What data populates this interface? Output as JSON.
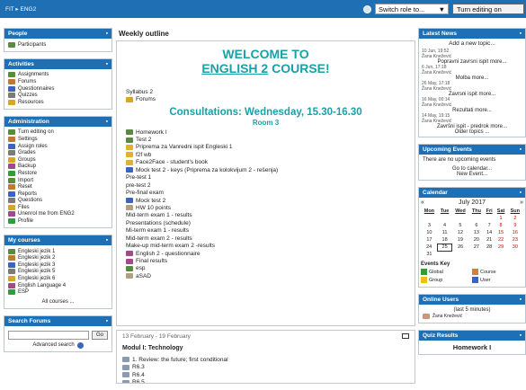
{
  "topbar": {
    "breadcrumb": "FIT  ▸  ENG2",
    "switch_role": "Switch role to...",
    "switch_arrow": "▼",
    "turn_editing": "Turn editing on"
  },
  "left": {
    "people": {
      "title": "People",
      "items": [
        {
          "label": "Participants",
          "icon": "people-icon"
        }
      ]
    },
    "activities": {
      "title": "Activities",
      "items": [
        {
          "label": "Assignments"
        },
        {
          "label": "Forums"
        },
        {
          "label": "Questionnaires"
        },
        {
          "label": "Quizzes"
        },
        {
          "label": "Resources"
        }
      ]
    },
    "administration": {
      "title": "Administration",
      "items": [
        {
          "label": "Turn editing on"
        },
        {
          "label": "Settings"
        },
        {
          "label": "Assign roles"
        },
        {
          "label": "Grades"
        },
        {
          "label": "Groups"
        },
        {
          "label": "Backup"
        },
        {
          "label": "Restore"
        },
        {
          "label": "Import"
        },
        {
          "label": "Reset"
        },
        {
          "label": "Reports"
        },
        {
          "label": "Questions"
        },
        {
          "label": "Files"
        },
        {
          "label": "Unenrol me from ENG2"
        },
        {
          "label": "Profile"
        }
      ]
    },
    "courses": {
      "title": "My courses",
      "items": [
        {
          "label": "Engleski jezik 1"
        },
        {
          "label": "Engleski jezik 2"
        },
        {
          "label": "Engleski jezik 3"
        },
        {
          "label": "Engleski jezik 5"
        },
        {
          "label": "Engleski jezik 6"
        },
        {
          "label": "English Language 4"
        },
        {
          "label": "ESP"
        }
      ],
      "all": "All courses ..."
    },
    "search": {
      "title": "Search Forums",
      "go": "Go",
      "advanced": "Advanced search"
    }
  },
  "center": {
    "heading": "Weekly outline",
    "welcome_line1": "WELCOME TO",
    "welcome_line2a": "ENGLISH 2",
    "welcome_line2b": " COURSE!",
    "syllabus": "Syllabus 2",
    "forums": "Forums",
    "consultations": "Consultations: Wednesday, 15.30-16.30",
    "room": "Room 3",
    "items": [
      {
        "label": "Homework I",
        "icon": "assignment"
      },
      {
        "label": "Test 2",
        "icon": "assignment"
      },
      {
        "label": "Priprema za Vanredni ispit Engleski 1",
        "icon": "folder"
      },
      {
        "label": "f2f wb",
        "icon": "folder"
      },
      {
        "label": "Face2Face - student's book",
        "icon": "folder"
      },
      {
        "label": "Mock test 2 - keys (Priprema za kolokvijum 2 - rešenja)",
        "icon": "doc"
      },
      {
        "label": "Pre-test 1",
        "icon": ""
      },
      {
        "label": "pre-test 2",
        "icon": ""
      },
      {
        "label": "Pre-final exam",
        "icon": ""
      },
      {
        "label": "Mock test 2",
        "icon": "doc"
      },
      {
        "label": "HW 10 points",
        "icon": "page"
      },
      {
        "label": "Mid-term exam 1 - results",
        "icon": ""
      },
      {
        "label": "Presentations (schedule)",
        "icon": ""
      },
      {
        "label": "Mi-term exam 1 - results",
        "icon": ""
      },
      {
        "label": "Mid-term exam 2 - results",
        "icon": ""
      },
      {
        "label": "Make-up mid-term exam 2 -results",
        "icon": ""
      },
      {
        "label": "English 2 - questionnaire",
        "icon": "quiz"
      },
      {
        "label": "Final results",
        "icon": "quiz"
      },
      {
        "label": "esp",
        "icon": "assignment"
      },
      {
        "label": "aSAD",
        "icon": "page"
      }
    ],
    "week2": {
      "date": "13 February - 19 February",
      "title": "Modul I: Technology",
      "items": [
        {
          "label": "1. Review: the future; first conditional"
        },
        {
          "label": "R6.3"
        },
        {
          "label": "R6.4"
        },
        {
          "label": "R6.5"
        }
      ]
    }
  },
  "right": {
    "news": {
      "title": "Latest News",
      "add": "Add a new topic...",
      "items": [
        {
          "date": "10 Jun, 19:52",
          "author": "Žana Knežević",
          "title": "Popravni zavrsni ispit more..."
        },
        {
          "date": "6 Jun, 17:18",
          "author": "Žana Knežević",
          "title": "Molba more..."
        },
        {
          "date": "26 May, 17:18",
          "author": "Žana Knežević",
          "title": "Zavrsni ispit more..."
        },
        {
          "date": "16 May, 00:14",
          "author": "Žana Knežević",
          "title": "Rezultati more..."
        },
        {
          "date": "14 May, 19:15",
          "author": "Žana Knežević",
          "title": "Završni ispit - predrok more..."
        }
      ],
      "older": "Older topics ..."
    },
    "upcoming": {
      "title": "Upcoming Events",
      "none": "There are no upcoming events",
      "goto": "Go to calendar...",
      "new": "New Event..."
    },
    "calendar": {
      "title": "Calendar",
      "month": "July 2017",
      "prev": "«",
      "next": "»",
      "days": [
        "Mon",
        "Tue",
        "Wed",
        "Thu",
        "Fri",
        "Sat",
        "Sun"
      ],
      "weeks": [
        [
          "",
          "",
          "",
          "",
          "",
          "1",
          "2"
        ],
        [
          "3",
          "4",
          "5",
          "6",
          "7",
          "8",
          "9"
        ],
        [
          "10",
          "11",
          "12",
          "13",
          "14",
          "15",
          "16"
        ],
        [
          "17",
          "18",
          "19",
          "20",
          "21",
          "22",
          "23"
        ],
        [
          "24",
          "25",
          "26",
          "27",
          "28",
          "29",
          "30"
        ],
        [
          "31",
          "",
          "",
          "",
          "",
          "",
          ""
        ]
      ],
      "today": "25",
      "events_key": "Events Key",
      "keys": [
        {
          "label": "Global",
          "color": "#2e9e3a"
        },
        {
          "label": "Course",
          "color": "#e07a2e"
        },
        {
          "label": "Group",
          "color": "#e8c020"
        },
        {
          "label": "User",
          "color": "#3a64c0"
        }
      ]
    },
    "online": {
      "title": "Online Users",
      "period": "(last 5 minutes)",
      "user": "Žana Knežević"
    },
    "quiz": {
      "title": "Quiz Results",
      "name": "Homework I"
    },
    "colors": {
      "brand": "#1f6fb5",
      "accent": "#1aa0a7"
    }
  }
}
